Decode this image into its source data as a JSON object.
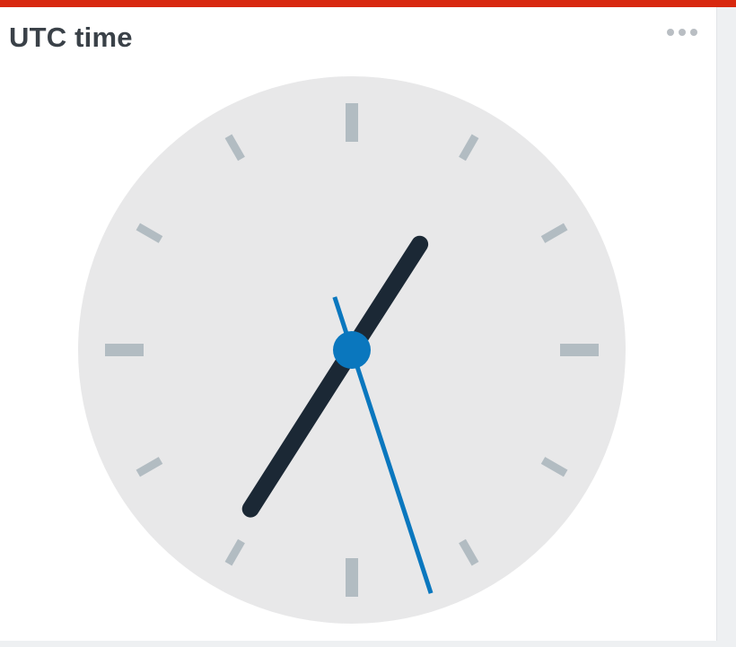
{
  "widget": {
    "title": "UTC time",
    "menu_icon": "ellipsis-icon"
  },
  "clock": {
    "time": {
      "hours": 7,
      "minutes": 5,
      "seconds": 27
    },
    "colors": {
      "face": "#e8e8e9",
      "ticks": "#b2bcc2",
      "hour_hand": "#1b2835",
      "minute_hand": "#1b2835",
      "second_hand": "#0a77be",
      "center_cap": "#0a77be",
      "accent_bar": "#d8280f"
    }
  }
}
